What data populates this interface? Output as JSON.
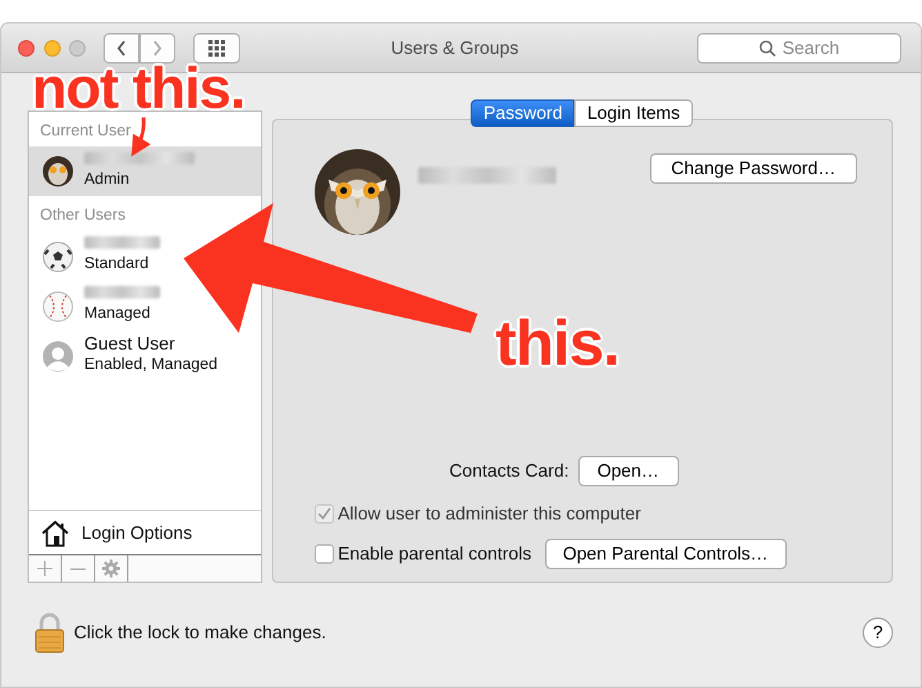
{
  "window": {
    "title": "Users & Groups"
  },
  "search": {
    "placeholder": "Search"
  },
  "sidebar": {
    "sections": [
      {
        "heading": "Current User",
        "users": [
          {
            "kind": "blurred",
            "avatar": {
              "kind": "owl"
            },
            "role": "Admin",
            "selected": true
          }
        ]
      },
      {
        "heading": "Other Users",
        "users": [
          {
            "kind": "blurred",
            "avatar": {
              "kind": "soccer"
            },
            "role": "Standard",
            "selected": false
          },
          {
            "kind": "blurred",
            "avatar": {
              "kind": "baseball"
            },
            "role": "Managed",
            "selected": false
          },
          {
            "kind": "named",
            "avatar": {
              "kind": "guest"
            },
            "name": "Guest User",
            "role": "Enabled, Managed",
            "selected": false
          }
        ]
      }
    ],
    "login_options": "Login Options"
  },
  "tabs": [
    {
      "label": "Password",
      "selected": true
    },
    {
      "label": "Login Items",
      "selected": false
    }
  ],
  "panel": {
    "change_password": "Change Password…",
    "contacts_label": "Contacts Card:",
    "contacts_button": "Open…",
    "checkboxes": [
      {
        "label": "Allow user to administer this computer",
        "checked": true,
        "disabled": true
      },
      {
        "label": "Enable parental controls",
        "checked": false,
        "disabled": false,
        "button": "Open Parental Controls…"
      }
    ]
  },
  "lock_text": "Click the lock to make changes.",
  "help": "?",
  "annotations": [
    {
      "text": "not this."
    },
    {
      "text": "this."
    }
  ]
}
